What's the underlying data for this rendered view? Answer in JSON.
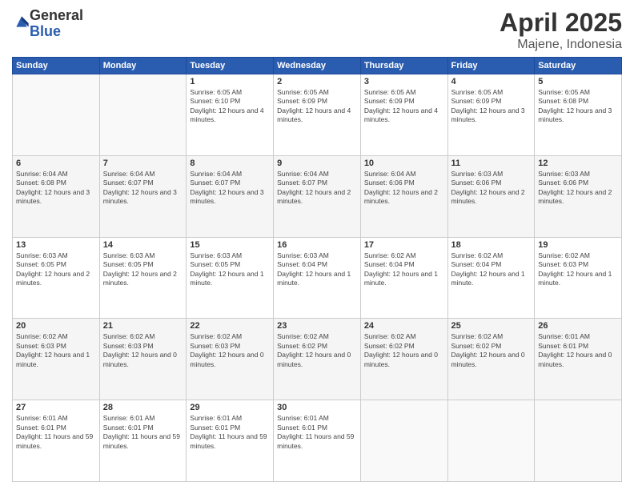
{
  "logo": {
    "general": "General",
    "blue": "Blue"
  },
  "header": {
    "month": "April 2025",
    "location": "Majene, Indonesia"
  },
  "weekdays": [
    "Sunday",
    "Monday",
    "Tuesday",
    "Wednesday",
    "Thursday",
    "Friday",
    "Saturday"
  ],
  "weeks": [
    [
      {
        "day": "",
        "info": ""
      },
      {
        "day": "",
        "info": ""
      },
      {
        "day": "1",
        "info": "Sunrise: 6:05 AM\nSunset: 6:10 PM\nDaylight: 12 hours and 4 minutes."
      },
      {
        "day": "2",
        "info": "Sunrise: 6:05 AM\nSunset: 6:09 PM\nDaylight: 12 hours and 4 minutes."
      },
      {
        "day": "3",
        "info": "Sunrise: 6:05 AM\nSunset: 6:09 PM\nDaylight: 12 hours and 4 minutes."
      },
      {
        "day": "4",
        "info": "Sunrise: 6:05 AM\nSunset: 6:09 PM\nDaylight: 12 hours and 3 minutes."
      },
      {
        "day": "5",
        "info": "Sunrise: 6:05 AM\nSunset: 6:08 PM\nDaylight: 12 hours and 3 minutes."
      }
    ],
    [
      {
        "day": "6",
        "info": "Sunrise: 6:04 AM\nSunset: 6:08 PM\nDaylight: 12 hours and 3 minutes."
      },
      {
        "day": "7",
        "info": "Sunrise: 6:04 AM\nSunset: 6:07 PM\nDaylight: 12 hours and 3 minutes."
      },
      {
        "day": "8",
        "info": "Sunrise: 6:04 AM\nSunset: 6:07 PM\nDaylight: 12 hours and 3 minutes."
      },
      {
        "day": "9",
        "info": "Sunrise: 6:04 AM\nSunset: 6:07 PM\nDaylight: 12 hours and 2 minutes."
      },
      {
        "day": "10",
        "info": "Sunrise: 6:04 AM\nSunset: 6:06 PM\nDaylight: 12 hours and 2 minutes."
      },
      {
        "day": "11",
        "info": "Sunrise: 6:03 AM\nSunset: 6:06 PM\nDaylight: 12 hours and 2 minutes."
      },
      {
        "day": "12",
        "info": "Sunrise: 6:03 AM\nSunset: 6:06 PM\nDaylight: 12 hours and 2 minutes."
      }
    ],
    [
      {
        "day": "13",
        "info": "Sunrise: 6:03 AM\nSunset: 6:05 PM\nDaylight: 12 hours and 2 minutes."
      },
      {
        "day": "14",
        "info": "Sunrise: 6:03 AM\nSunset: 6:05 PM\nDaylight: 12 hours and 2 minutes."
      },
      {
        "day": "15",
        "info": "Sunrise: 6:03 AM\nSunset: 6:05 PM\nDaylight: 12 hours and 1 minute."
      },
      {
        "day": "16",
        "info": "Sunrise: 6:03 AM\nSunset: 6:04 PM\nDaylight: 12 hours and 1 minute."
      },
      {
        "day": "17",
        "info": "Sunrise: 6:02 AM\nSunset: 6:04 PM\nDaylight: 12 hours and 1 minute."
      },
      {
        "day": "18",
        "info": "Sunrise: 6:02 AM\nSunset: 6:04 PM\nDaylight: 12 hours and 1 minute."
      },
      {
        "day": "19",
        "info": "Sunrise: 6:02 AM\nSunset: 6:03 PM\nDaylight: 12 hours and 1 minute."
      }
    ],
    [
      {
        "day": "20",
        "info": "Sunrise: 6:02 AM\nSunset: 6:03 PM\nDaylight: 12 hours and 1 minute."
      },
      {
        "day": "21",
        "info": "Sunrise: 6:02 AM\nSunset: 6:03 PM\nDaylight: 12 hours and 0 minutes."
      },
      {
        "day": "22",
        "info": "Sunrise: 6:02 AM\nSunset: 6:03 PM\nDaylight: 12 hours and 0 minutes."
      },
      {
        "day": "23",
        "info": "Sunrise: 6:02 AM\nSunset: 6:02 PM\nDaylight: 12 hours and 0 minutes."
      },
      {
        "day": "24",
        "info": "Sunrise: 6:02 AM\nSunset: 6:02 PM\nDaylight: 12 hours and 0 minutes."
      },
      {
        "day": "25",
        "info": "Sunrise: 6:02 AM\nSunset: 6:02 PM\nDaylight: 12 hours and 0 minutes."
      },
      {
        "day": "26",
        "info": "Sunrise: 6:01 AM\nSunset: 6:01 PM\nDaylight: 12 hours and 0 minutes."
      }
    ],
    [
      {
        "day": "27",
        "info": "Sunrise: 6:01 AM\nSunset: 6:01 PM\nDaylight: 11 hours and 59 minutes."
      },
      {
        "day": "28",
        "info": "Sunrise: 6:01 AM\nSunset: 6:01 PM\nDaylight: 11 hours and 59 minutes."
      },
      {
        "day": "29",
        "info": "Sunrise: 6:01 AM\nSunset: 6:01 PM\nDaylight: 11 hours and 59 minutes."
      },
      {
        "day": "30",
        "info": "Sunrise: 6:01 AM\nSunset: 6:01 PM\nDaylight: 11 hours and 59 minutes."
      },
      {
        "day": "",
        "info": ""
      },
      {
        "day": "",
        "info": ""
      },
      {
        "day": "",
        "info": ""
      }
    ]
  ]
}
